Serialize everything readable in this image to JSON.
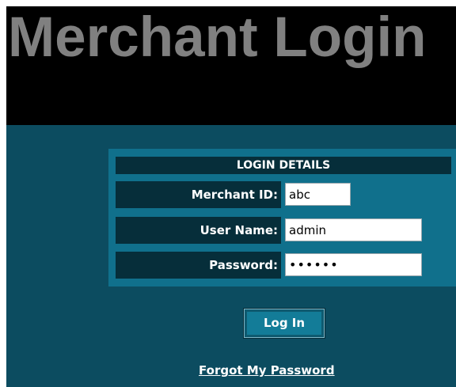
{
  "header": {
    "title": "Merchant Login"
  },
  "login_panel": {
    "section_title": "LOGIN DETAILS",
    "fields": [
      {
        "label": "Merchant ID:",
        "value": "abc",
        "type": "text"
      },
      {
        "label": "User Name:",
        "value": "admin",
        "type": "text"
      },
      {
        "label": "Password:",
        "value": "••••••",
        "type": "password"
      }
    ]
  },
  "actions": {
    "login_label": "Log In",
    "forgot_password_label": "Forgot My Password"
  },
  "colors": {
    "header_background": "#000000",
    "title_text": "#808080",
    "page_background": "#0c4c60",
    "panel_background": "#10708c",
    "label_background": "#062e3a",
    "button_face": "#137c98"
  }
}
